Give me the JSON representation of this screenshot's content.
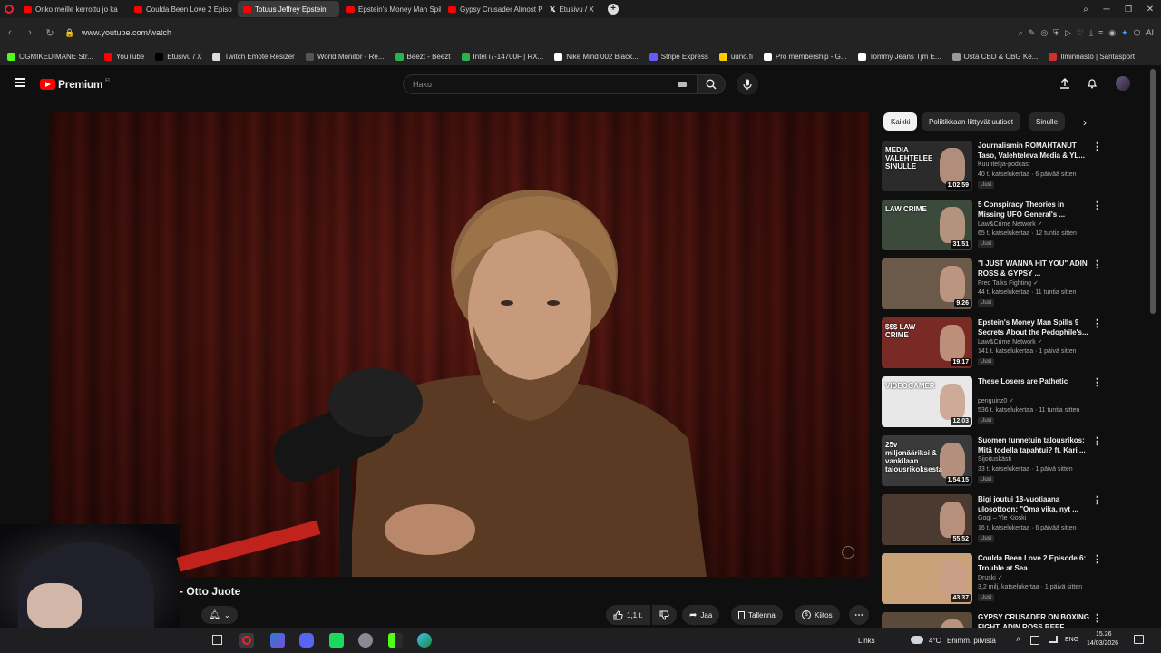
{
  "tabs": [
    {
      "label": "Onko meille kerrottu jo ka",
      "icon": "youtube-icon",
      "active": false
    },
    {
      "label": "Coulda Been Love 2 Episo",
      "icon": "youtube-icon",
      "active": false
    },
    {
      "label": "Totuus Jeffrey Epstein",
      "icon": "youtube-icon",
      "active": true
    },
    {
      "label": "Epstein's Money Man Spil",
      "icon": "youtube-icon",
      "active": false
    },
    {
      "label": "Gypsy Crusader Almost P",
      "icon": "youtube-icon",
      "active": false
    },
    {
      "label": "Etusivu / X",
      "icon": "x-icon",
      "active": false
    }
  ],
  "url": "www.youtube.com/watch",
  "bookmarks": [
    {
      "label": "OGMIKEDIMANE Str...",
      "color": "#53fc18"
    },
    {
      "label": "YouTube",
      "color": "#ff0000"
    },
    {
      "label": "Etusivu / X",
      "color": "#000000"
    },
    {
      "label": "Twitch Emote Resizer",
      "color": "#dddddd"
    },
    {
      "label": "World Monitor - Re...",
      "color": "#555555"
    },
    {
      "label": "Beezt - Beezt",
      "color": "#2bb24c"
    },
    {
      "label": "Intel i7-14700F | RX...",
      "color": "#2bb24c"
    },
    {
      "label": "Nike Mind 002 Black...",
      "color": "#ffffff"
    },
    {
      "label": "Stripe Express",
      "color": "#635bff"
    },
    {
      "label": "uuno.fi",
      "color": "#ffcc00"
    },
    {
      "label": "Pro membership - G...",
      "color": "#ffffff"
    },
    {
      "label": "Tommy Jeans Tjm E...",
      "color": "#ffffff"
    },
    {
      "label": "Osta CBD & CBG Ke...",
      "color": "#999999"
    },
    {
      "label": "Ilminnasto | Santasport",
      "color": "#d32f2f"
    }
  ],
  "header": {
    "logo_text": "Premium",
    "logo_sup": "FI",
    "search_placeholder": "Haku"
  },
  "chips": [
    {
      "label": "Kaikki",
      "selected": true
    },
    {
      "label": "Poliitikkaan liittyvät uutiset",
      "selected": false
    },
    {
      "label": "Sinulle",
      "selected": false
    }
  ],
  "recommendations": [
    {
      "title": "Journalismin ROMAHTANUT Taso, Valehteleva Media & YL...",
      "channel": "Kuuntelija-podcast",
      "meta": "40 t. katselukertaa · 6 päivää sitten",
      "badge": "Uusi",
      "duration": "1.02.59",
      "thumb_text": "MEDIA VALEHTELEE SINULLE",
      "thumb_color": "#2b2b2b"
    },
    {
      "title": "5 Conspiracy Theories in Missing UFO General's ...",
      "channel": "Law&Crime Network ✓",
      "meta": "65 t. katselukertaa · 12 tuntia sitten",
      "badge": "Uusi",
      "duration": "31.51",
      "thumb_text": "LAW CRIME",
      "thumb_color": "#3b4a3b"
    },
    {
      "title": "\"I JUST WANNA HIT YOU\" ADIN ROSS & GYPSY ...",
      "channel": "Fred Talks Fighting ✓",
      "meta": "44 t. katselukertaa · 11 tuntia sitten",
      "badge": "Uusi",
      "duration": "9.26",
      "thumb_text": "",
      "thumb_color": "#6b5a4a"
    },
    {
      "title": "Epstein's Money Man Spills 9 Secrets About the Pedophile's...",
      "channel": "Law&Crime Network ✓",
      "meta": "141 t. katselukertaa · 1 päivä sitten",
      "badge": "Uusi",
      "duration": "19.17",
      "thumb_text": "$$$ LAW CRIME",
      "thumb_color": "#7a2a24"
    },
    {
      "title": "These Losers are Pathetic",
      "channel": "penguinz0 ✓",
      "meta": "536 t. katselukertaa · 11 tuntia sitten",
      "badge": "Uusi",
      "duration": "12.03",
      "thumb_text": "VIDEOGAMER",
      "thumb_color": "#e8e8e8"
    },
    {
      "title": "Suomen tunnetuin talousrikos: Mitä todella tapahtui? ft. Kari ...",
      "channel": "Sijoituskästi",
      "meta": "33 t. katselukertaa · 1 päivä sitten",
      "badge": "Uusi",
      "duration": "1.54.15",
      "thumb_text": "25v miljonääriksi & vankilaan talousrikoksesta",
      "thumb_color": "#3a3a3a"
    },
    {
      "title": "Bigi joutui 18-vuotiaana ulosottoon: \"Oma vika, nyt ...",
      "channel": "Gogi – Yle Kioski",
      "meta": "16 t. katselukertaa · 6 päivää sitten",
      "badge": "Uusi",
      "duration": "55.52",
      "thumb_text": "",
      "thumb_color": "#4a3a30"
    },
    {
      "title": "Coulda Been Love 2 Episode 6: Trouble at Sea",
      "channel": "Druski ✓",
      "meta": "3,2 milj. katselukertaa · 1 päivä sitten",
      "badge": "Uusi",
      "duration": "43.37",
      "thumb_text": "",
      "thumb_color": "#c9a27a"
    },
    {
      "title": "GYPSY CRUSADER ON BOXING FIGHT, ADIN ROSS BEEF ...",
      "channel": "",
      "meta": "",
      "badge": "",
      "duration": "",
      "thumb_text": "",
      "thumb_color": "#5a4a3a"
    }
  ],
  "video": {
    "title_fragment": "- Otto Juote",
    "like_count": "1,1 t.",
    "share_label": "Jaa",
    "save_label": "Tallenna",
    "thanks_label": "Kiitos"
  },
  "taskbar": {
    "links_label": "Links",
    "weather_temp": "4°C",
    "weather_text": "Enimm. pilvistä",
    "lang": "ENG",
    "time": "15.26",
    "date": "14/03/2026"
  }
}
